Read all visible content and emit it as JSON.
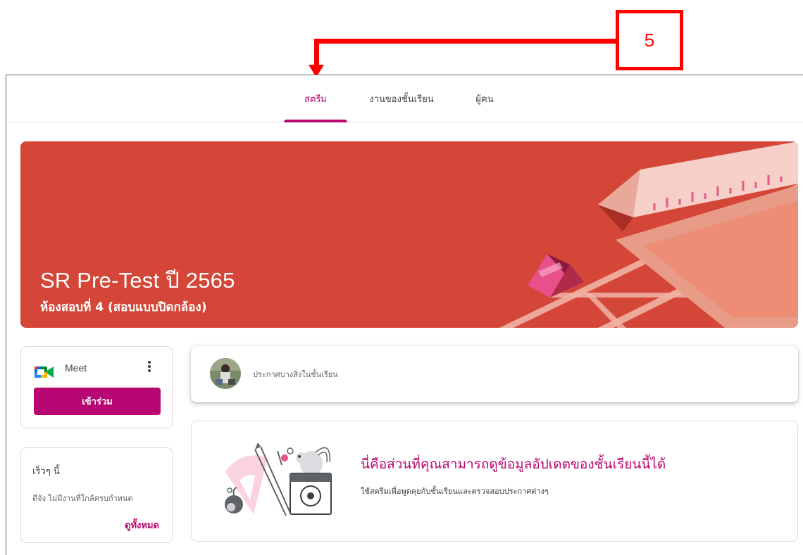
{
  "callout": {
    "number": "5"
  },
  "tabs": [
    {
      "label": "สตรีม",
      "active": true
    },
    {
      "label": "งานของชั้นเรียน",
      "active": false
    },
    {
      "label": "ผู้คน",
      "active": false
    }
  ],
  "banner": {
    "title": "SR Pre-Test ปี 2565",
    "subtitle": "ห้องสอบที่ 4 (สอบแบบปิดกล้อง)",
    "background_color": "#d44638"
  },
  "meet": {
    "label": "Meet",
    "join_label": "เข้าร่วม",
    "logo_icon": "google-meet-icon",
    "menu_icon": "more-vert-icon"
  },
  "upcoming": {
    "title": "เร็วๆ นี้",
    "message": "ดีจัง ไม่มีงานที่ใกล้ครบกำหนด",
    "view_all_label": "ดูทั้งหมด"
  },
  "announce": {
    "placeholder": "ประกาศบางสิ่งในชั้นเรียน"
  },
  "info": {
    "title": "นี่คือส่วนที่คุณสามารถดูข้อมูลอัปเดตของชั้นเรียนนี้ได้",
    "description": "ใช้สตรีมเพื่อพูดคุยกับชั้นเรียนและตรวจสอบประกาศต่างๆ"
  },
  "colors": {
    "accent": "#b80672",
    "callout": "#ff0000"
  }
}
